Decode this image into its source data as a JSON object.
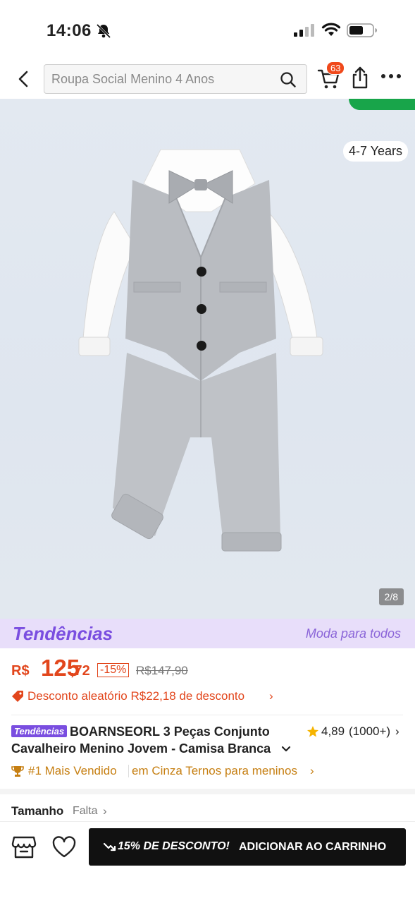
{
  "status_bar": {
    "time": "14:06"
  },
  "header": {
    "search_placeholder": "Roupa Social Menino 4 Anos",
    "cart_count": "63"
  },
  "gallery": {
    "age_tag": "4-7 Years",
    "counter": "2/8"
  },
  "trend_banner": {
    "logo": "Tendências",
    "slogan": "Moda para todos"
  },
  "price": {
    "currency": "R$",
    "integer": "125",
    "decimal": ",72",
    "discount": "-15%",
    "original": "R$147,90"
  },
  "random_discount": {
    "text": "Desconto aleatório R$22,18 de desconto",
    "chevron": "›"
  },
  "product": {
    "tag": "Tendências",
    "title_line1": "BOARNSEORL 3 Peças Conjunto",
    "title_line2": "Cavalheiro Menino Jovem - Camisa Branca"
  },
  "rating": {
    "value": "4,89",
    "count": "(1000+)",
    "chevron": "›"
  },
  "bestseller": {
    "rank": "#1 Mais Vendido",
    "category": "em Cinza Ternos para meninos",
    "chevron": "›"
  },
  "size": {
    "label": "Tamanho",
    "status": "Falta",
    "chevron": "›"
  },
  "bottom_bar": {
    "promo": "15% DE DESCONTO!",
    "cta": "ADICIONAR AO CARRINHO"
  },
  "colors": {
    "accent": "#e2461c",
    "trend_purple": "#7a4ee0",
    "bestseller_gold": "#c67f12",
    "cta_bg": "#111111"
  }
}
